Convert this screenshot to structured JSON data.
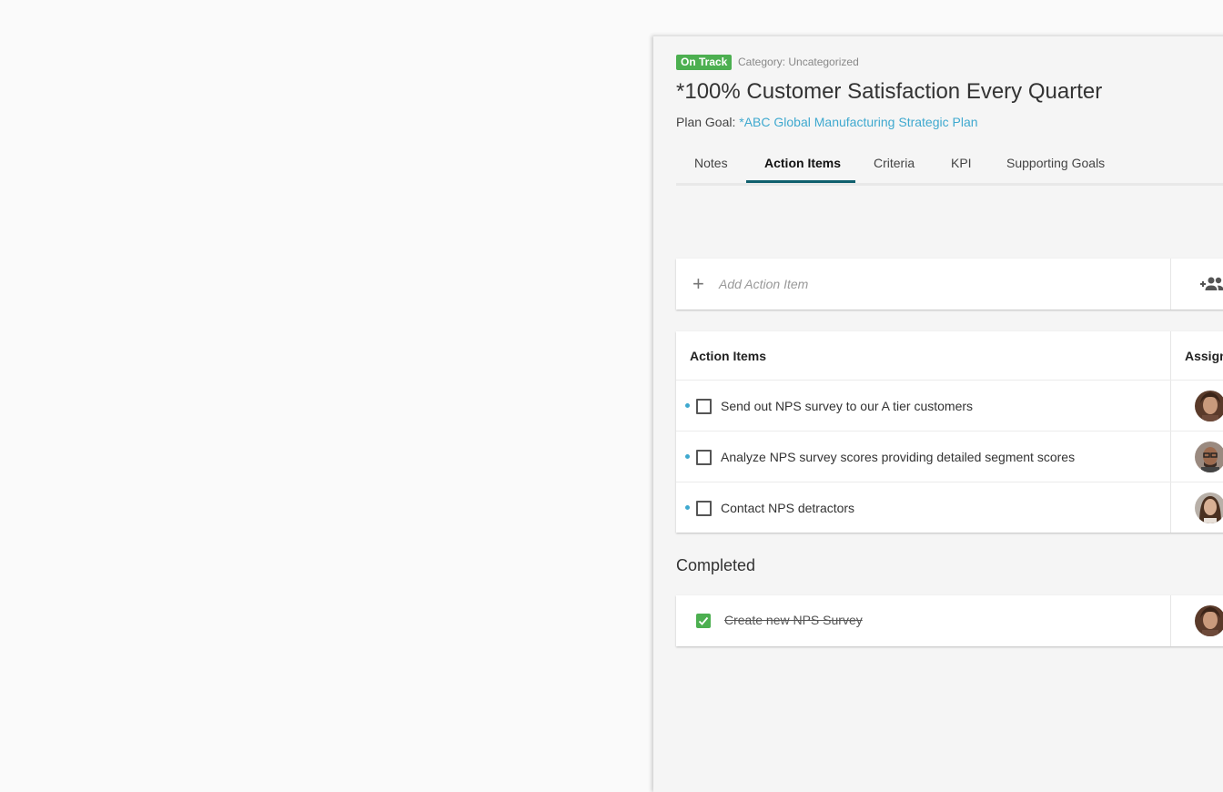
{
  "goal": {
    "status_badge": "On Track",
    "category": "Category: Uncategorized",
    "title": "*100% Customer Satisfaction Every Quarter",
    "plan_goal_label": "Plan Goal:",
    "plan_goal_link": "*ABC Global Manufacturing Strategic Plan"
  },
  "tabs": [
    {
      "label": "Notes",
      "active": false
    },
    {
      "label": "Action Items",
      "active": true
    },
    {
      "label": "Criteria",
      "active": false
    },
    {
      "label": "KPI",
      "active": false
    },
    {
      "label": "Supporting Goals",
      "active": false
    }
  ],
  "add_item": {
    "placeholder": "Add Action Item"
  },
  "action_items": {
    "header": "Action Items",
    "assignee_header": "Assign",
    "rows": [
      {
        "text": "Send out NPS survey to our A tier customers",
        "avatar": "female-avatar-1"
      },
      {
        "text": "Analyze NPS survey scores providing detailed segment scores",
        "avatar": "male-avatar"
      },
      {
        "text": "Contact NPS detractors",
        "avatar": "female-avatar-2"
      }
    ]
  },
  "completed": {
    "label": "Completed",
    "rows": [
      {
        "text": "Create new NPS Survey",
        "avatar": "female-avatar-1"
      }
    ]
  },
  "colors": {
    "badge": "#4caf50",
    "link": "#3fa9cf",
    "active_tab_underline": "#10606e",
    "checked": "#4caf50"
  }
}
